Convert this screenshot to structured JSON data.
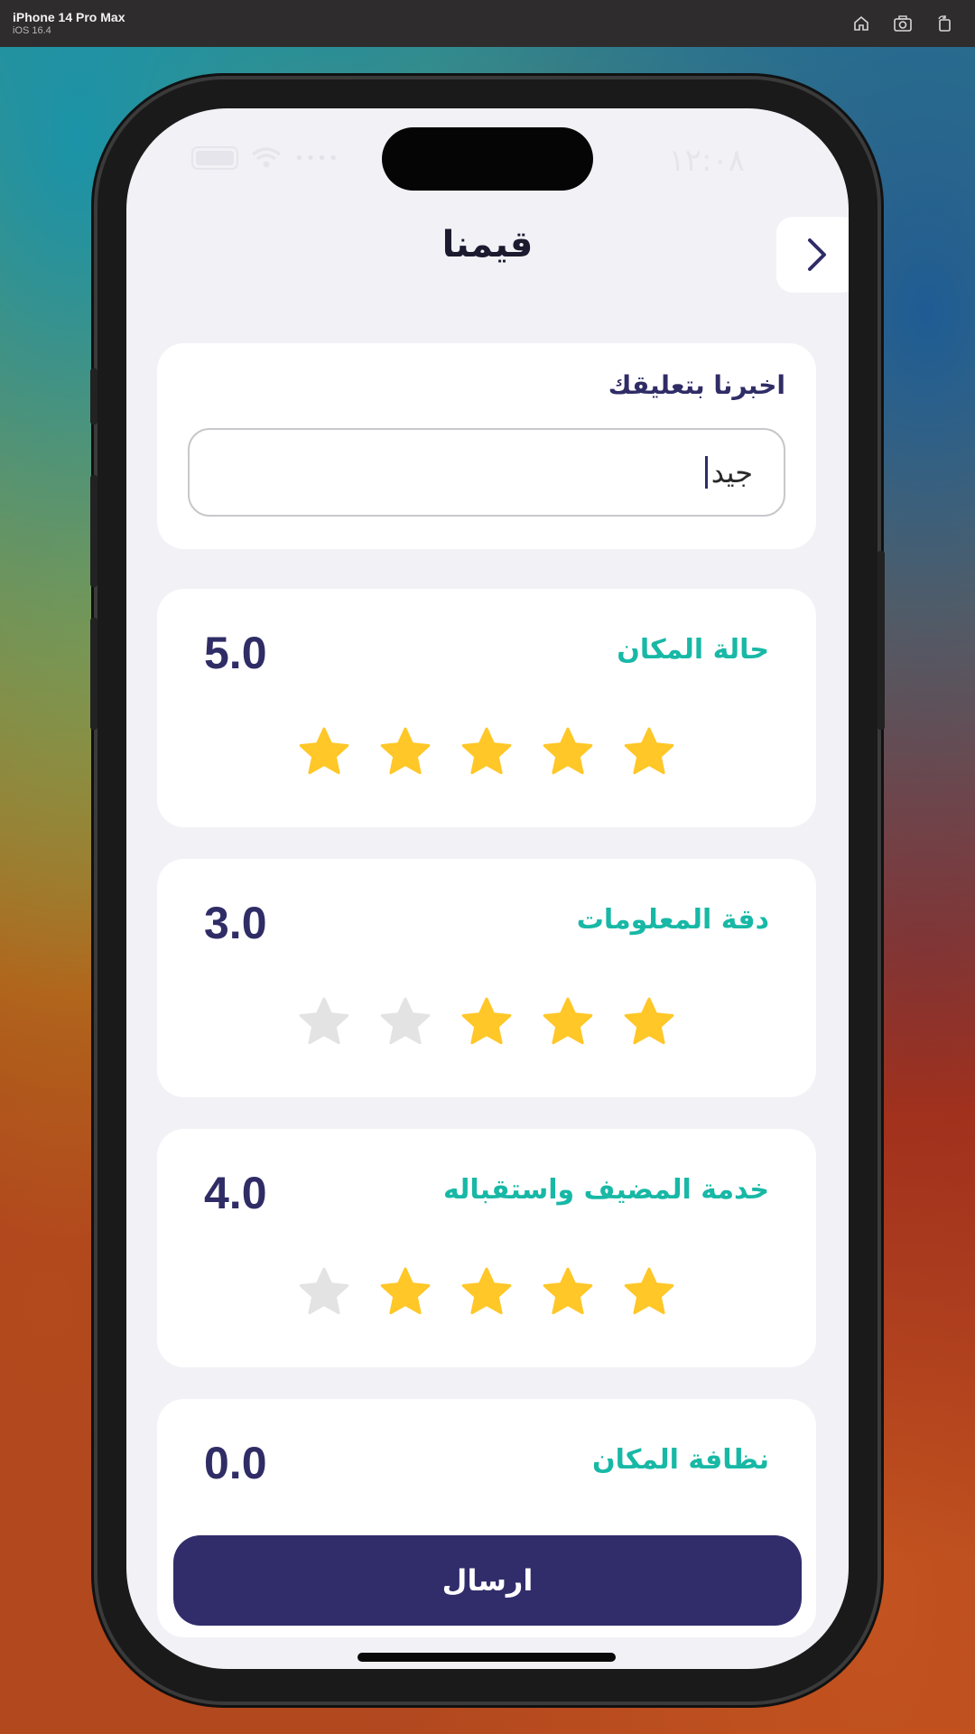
{
  "simulator": {
    "device": "iPhone 14 Pro Max",
    "os": "iOS 16.4",
    "icons": [
      "home-icon",
      "screenshot-icon",
      "rotate-icon"
    ]
  },
  "status_bar": {
    "time": "١٢:٠٨"
  },
  "header": {
    "title": "قيمنا",
    "back_icon": "chevron-right-icon"
  },
  "feedback": {
    "label": "اخبرنا بتعليقك",
    "value": "جيد"
  },
  "ratings": [
    {
      "label": "حالة المكان",
      "value": "5.0",
      "stars": 5
    },
    {
      "label": "دقة المعلومات",
      "value": "3.0",
      "stars": 3
    },
    {
      "label": "خدمة المضيف واستقباله",
      "value": "4.0",
      "stars": 4
    },
    {
      "label": "نظافة المكان",
      "value": "0.0",
      "stars": 0
    }
  ],
  "submit": {
    "label": "ارسال"
  },
  "colors": {
    "accent": "#312d6b",
    "label_teal": "#18b8a6",
    "star_filled": "#ffc727",
    "star_empty": "#e3e3e3"
  }
}
